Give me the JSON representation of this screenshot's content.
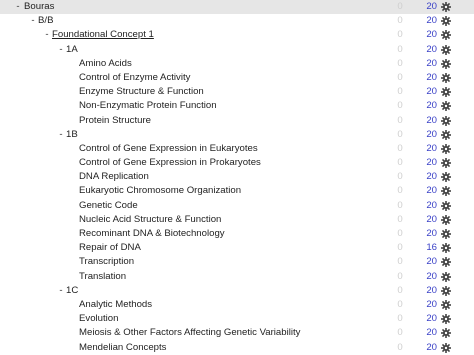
{
  "rows": [
    {
      "level": 0,
      "toggle": "-",
      "label": "Bouras",
      "zero": "0",
      "count": "20",
      "selected": true
    },
    {
      "level": 1,
      "toggle": "-",
      "label": "B/B",
      "zero": "0",
      "count": "20"
    },
    {
      "level": 2,
      "toggle": "-",
      "label": "Foundational Concept 1",
      "zero": "0",
      "count": "20",
      "link": true
    },
    {
      "level": 3,
      "toggle": "-",
      "label": "1A",
      "zero": "0",
      "count": "20"
    },
    {
      "level": 4,
      "label": "Amino Acids",
      "zero": "0",
      "count": "20"
    },
    {
      "level": 4,
      "label": "Control of Enzyme Activity",
      "zero": "0",
      "count": "20"
    },
    {
      "level": 4,
      "label": "Enzyme Structure & Function",
      "zero": "0",
      "count": "20"
    },
    {
      "level": 4,
      "label": "Non-Enzymatic Protein Function",
      "zero": "0",
      "count": "20"
    },
    {
      "level": 4,
      "label": "Protein Structure",
      "zero": "0",
      "count": "20"
    },
    {
      "level": 3,
      "toggle": "-",
      "label": "1B",
      "zero": "0",
      "count": "20"
    },
    {
      "level": 4,
      "label": "Control of Gene Expression in Eukaryotes",
      "zero": "0",
      "count": "20"
    },
    {
      "level": 4,
      "label": "Control of Gene Expression in Prokaryotes",
      "zero": "0",
      "count": "20"
    },
    {
      "level": 4,
      "label": "DNA Replication",
      "zero": "0",
      "count": "20"
    },
    {
      "level": 4,
      "label": "Eukaryotic Chromosome Organization",
      "zero": "0",
      "count": "20"
    },
    {
      "level": 4,
      "label": "Genetic Code",
      "zero": "0",
      "count": "20"
    },
    {
      "level": 4,
      "label": "Nucleic Acid Structure & Function",
      "zero": "0",
      "count": "20"
    },
    {
      "level": 4,
      "label": "Recominant DNA & Biotechnology",
      "zero": "0",
      "count": "20"
    },
    {
      "level": 4,
      "label": "Repair of DNA",
      "zero": "0",
      "count": "16"
    },
    {
      "level": 4,
      "label": "Transcription",
      "zero": "0",
      "count": "20"
    },
    {
      "level": 4,
      "label": "Translation",
      "zero": "0",
      "count": "20"
    },
    {
      "level": 3,
      "toggle": "-",
      "label": "1C",
      "zero": "0",
      "count": "20"
    },
    {
      "level": 4,
      "label": "Analytic Methods",
      "zero": "0",
      "count": "20"
    },
    {
      "level": 4,
      "label": "Evolution",
      "zero": "0",
      "count": "20"
    },
    {
      "level": 4,
      "label": "Meiosis & Other Factors Affecting Genetic Variability",
      "zero": "0",
      "count": "20"
    },
    {
      "level": 4,
      "label": "Mendelian Concepts",
      "zero": "0",
      "count": "20"
    }
  ],
  "icons": {
    "options": "gear-icon"
  },
  "colors": {
    "count": "#3a41c7",
    "zero": "#cfcfcf",
    "selected_row": "#e6e6e6",
    "gear": "#444444"
  }
}
